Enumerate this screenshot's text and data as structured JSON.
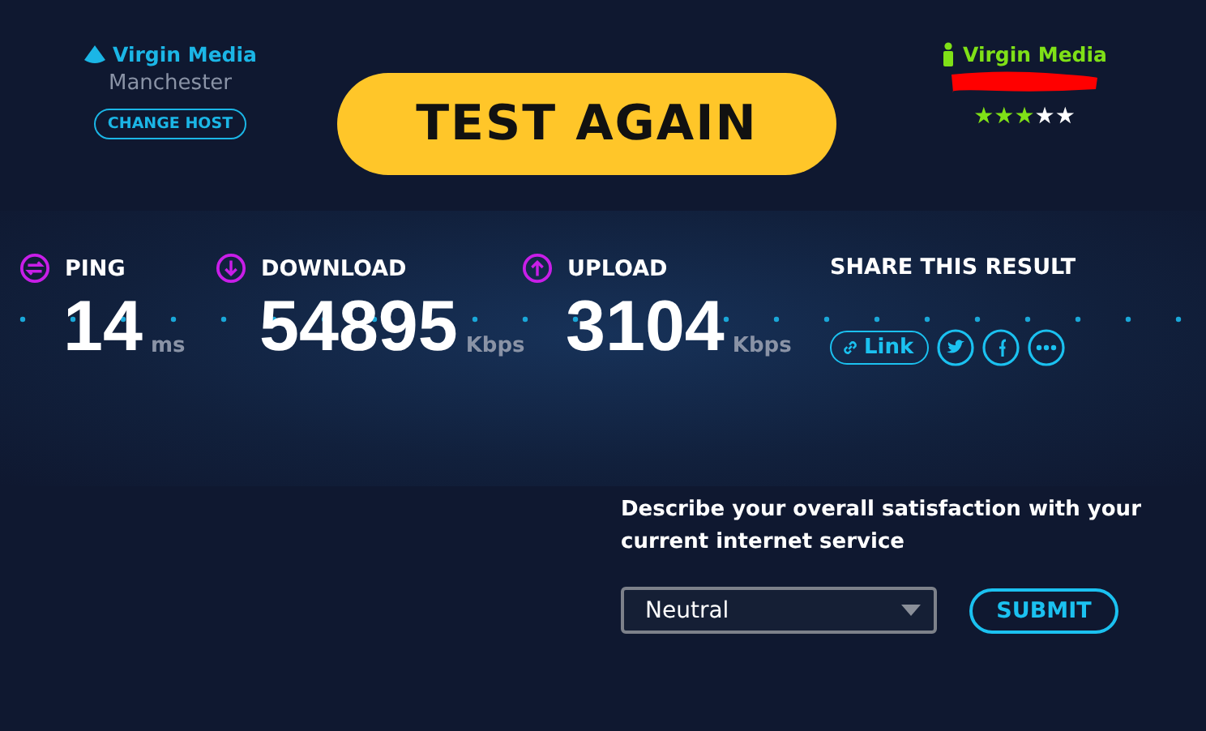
{
  "server": {
    "name": "Virgin Media",
    "location": "Manchester",
    "change_button": "CHANGE HOST"
  },
  "test_again": "TEST AGAIN",
  "isp": {
    "name": "Virgin Media",
    "stars": 3
  },
  "metrics": [
    {
      "kind": "ping",
      "label": "PING",
      "value": "14",
      "unit": "ms"
    },
    {
      "kind": "download",
      "label": "DOWNLOAD",
      "value": "54895",
      "unit": "Kbps"
    },
    {
      "kind": "upload",
      "label": "UPLOAD",
      "value": "3104",
      "unit": "Kbps"
    }
  ],
  "share": {
    "title": "SHARE THIS RESULT",
    "link": "Link"
  },
  "feedback": {
    "question": "Describe your overall satisfaction with your current internet service",
    "value": "Neutral",
    "submit": "SUBMIT"
  }
}
